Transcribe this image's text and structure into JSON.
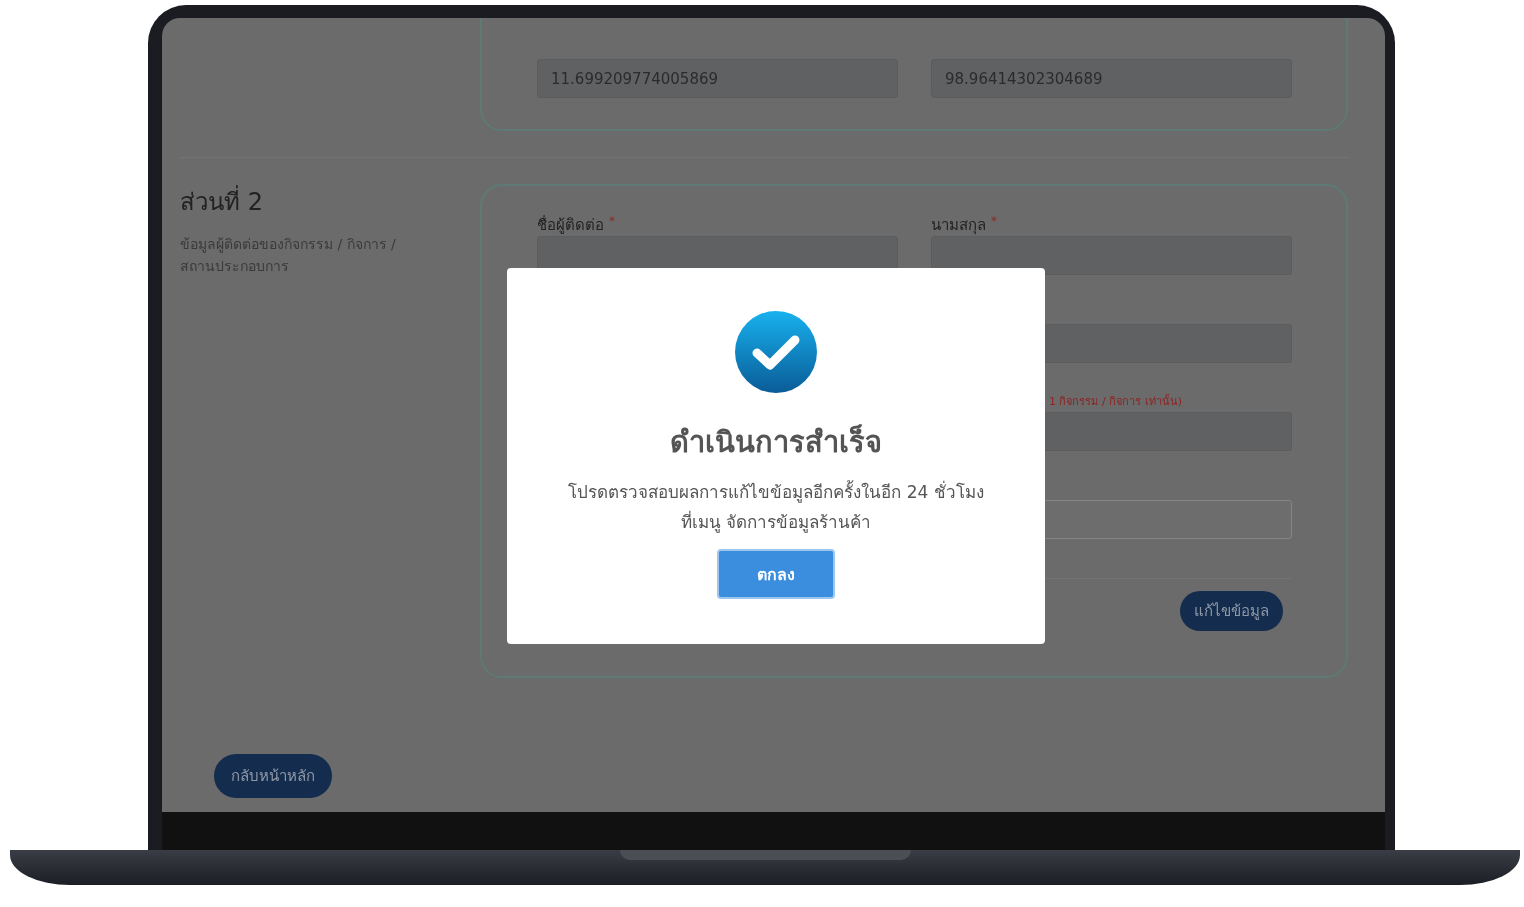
{
  "section_1": {
    "fields": [
      {
        "value": "11.699209774005869",
        "disabled": true
      },
      {
        "value": "98.96414302304689",
        "disabled": true
      }
    ]
  },
  "section_2": {
    "title": "ส่วนที่ 2",
    "subtitle": "ข้อมูลผู้ติดต่อของกิจกรรม / กิจการ / สถานประกอบการ",
    "fields": [
      {
        "label": "ชื่อผู้ติดต่อ",
        "required_mark": "*",
        "disabled": true
      },
      {
        "label": "นามสกุล",
        "required_mark": "*",
        "disabled": true
      },
      {
        "disabled": true
      },
      {
        "hint": "1 กิจกรรม / กิจการ เท่านั้น)",
        "disabled": true
      },
      {
        "disabled": false
      }
    ],
    "edit_button": "แก้ไขข้อมูล"
  },
  "back_button": "กลับหน้าหลัก",
  "dialog": {
    "title": "ดำเนินการสำเร็จ",
    "message": "โปรดตรวจสอบผลการแก้ไขข้อมูลอีกครั้งในอีก 24 ชั่วโมง ที่เมนู จัดการข้อมูลร้านค้า",
    "ok_button": "ตกลง"
  }
}
